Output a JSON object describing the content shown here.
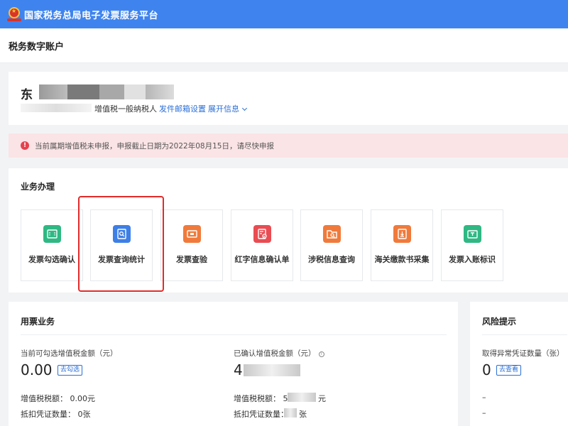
{
  "app": {
    "title": "国家税务总局电子发票服务平台"
  },
  "header": {
    "title": "税务数字账户"
  },
  "account": {
    "company_prefix": "东",
    "taxpayer_type": "增值税一般纳税人",
    "mailbox_link": "发件邮箱设置",
    "expand_link": "展开信息"
  },
  "alert": {
    "text": "当前属期增值税未申报，申报截止日期为2022年08月15日，请尽快申报"
  },
  "business": {
    "title": "业务办理",
    "tiles": [
      {
        "label": "发票勾选确认",
        "icon": "ticket-check-icon",
        "color": "#2fb883"
      },
      {
        "label": "发票查询统计",
        "icon": "document-search-icon",
        "color": "#3d7fe6"
      },
      {
        "label": "发票查验",
        "icon": "ticket-verify-icon",
        "color": "#f07a3b"
      },
      {
        "label": "红字信息确认单",
        "icon": "red-document-icon",
        "color": "#e94c52"
      },
      {
        "label": "涉税信息查询",
        "icon": "folder-search-icon",
        "color": "#f07a3b"
      },
      {
        "label": "海关缴款书采集",
        "icon": "customs-doc-icon",
        "color": "#f07a3b"
      },
      {
        "label": "发票入账标识",
        "icon": "ticket-mark-icon",
        "color": "#2fb883"
      }
    ]
  },
  "ticket": {
    "title": "用票业务",
    "left": {
      "amount_label": "当前可勾选增值税金额（元）",
      "amount_value": "0.00",
      "action": "去勾选",
      "tax_line": "增值税税额：  0.00元",
      "count_line": "抵扣凭证数量：  0张"
    },
    "right": {
      "amount_label": "已确认增值税金额（元）",
      "amount_prefix": "4",
      "tax_line_prefix": "增值税税额：  5",
      "tax_line_suffix": "元",
      "count_line_prefix": "抵扣凭证数量：",
      "count_line_suffix": "张"
    }
  },
  "risk": {
    "title": "风险提示",
    "label": "取得异常凭证数量（张）",
    "value": "0",
    "action": "去查看",
    "line1": "–",
    "line2": "–"
  }
}
